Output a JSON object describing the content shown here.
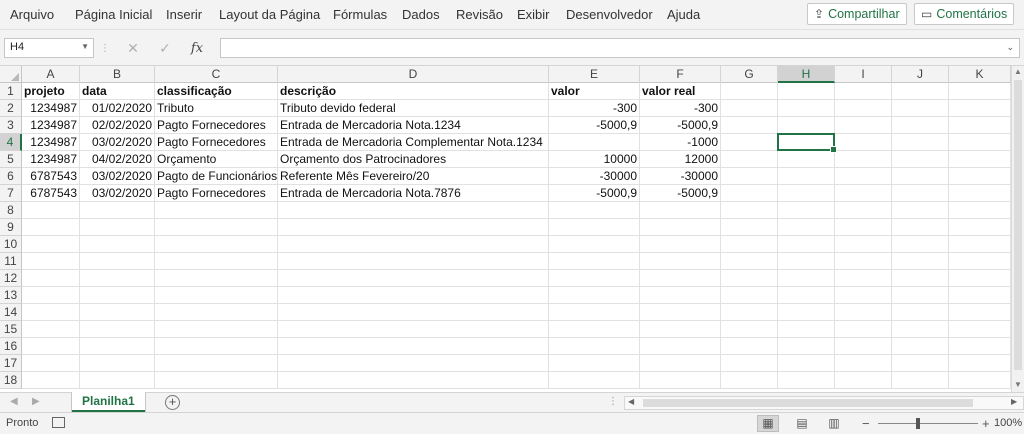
{
  "menu": {
    "items": [
      "Arquivo",
      "Página Inicial",
      "Inserir",
      "Layout da Página",
      "Fórmulas",
      "Dados",
      "Revisão",
      "Exibir",
      "Desenvolvedor",
      "Ajuda"
    ],
    "share_label": "Compartilhar",
    "comments_label": "Comentários"
  },
  "formula_bar": {
    "name_box": "H4",
    "formula": "",
    "fx_label": "fx"
  },
  "grid": {
    "columns": [
      "A",
      "B",
      "C",
      "D",
      "E",
      "F",
      "G",
      "H",
      "I",
      "J",
      "K"
    ],
    "selected_column": "H",
    "selected_row": 4,
    "row_numbers": [
      "1",
      "2",
      "3",
      "4",
      "5",
      "6",
      "7",
      "8",
      "9",
      "10",
      "11",
      "12",
      "13",
      "14",
      "15",
      "16",
      "17",
      "18"
    ],
    "rows": [
      [
        "projeto",
        "data",
        "classificação",
        "descrição",
        "valor",
        "valor real"
      ],
      [
        "1234987",
        "01/02/2020",
        "Tributo",
        "Tributo devido federal",
        "-300",
        "-300"
      ],
      [
        "1234987",
        "02/02/2020",
        "Pagto Fornecedores",
        "Entrada de Mercadoria Nota.1234",
        "-5000,9",
        "-5000,9"
      ],
      [
        "1234987",
        "03/02/2020",
        "Pagto Fornecedores",
        "Entrada de Mercadoria Complementar Nota.1234",
        "",
        "-1000"
      ],
      [
        "1234987",
        "04/02/2020",
        "Orçamento",
        "Orçamento dos Patrocinadores",
        "10000",
        "12000"
      ],
      [
        "6787543",
        "03/02/2020",
        "Pagto de Funcionários",
        "Referente Mês Fevereiro/20",
        "-30000",
        "-30000"
      ],
      [
        "6787543",
        "03/02/2020",
        "Pagto Fornecedores",
        "Entrada de Mercadoria Nota.7876",
        "-5000,9",
        "-5000,9"
      ]
    ]
  },
  "sheets": {
    "active": "Planilha1"
  },
  "status": {
    "text": "Pronto",
    "zoom": "100%",
    "zoom_minus": "−",
    "zoom_plus": "+"
  }
}
